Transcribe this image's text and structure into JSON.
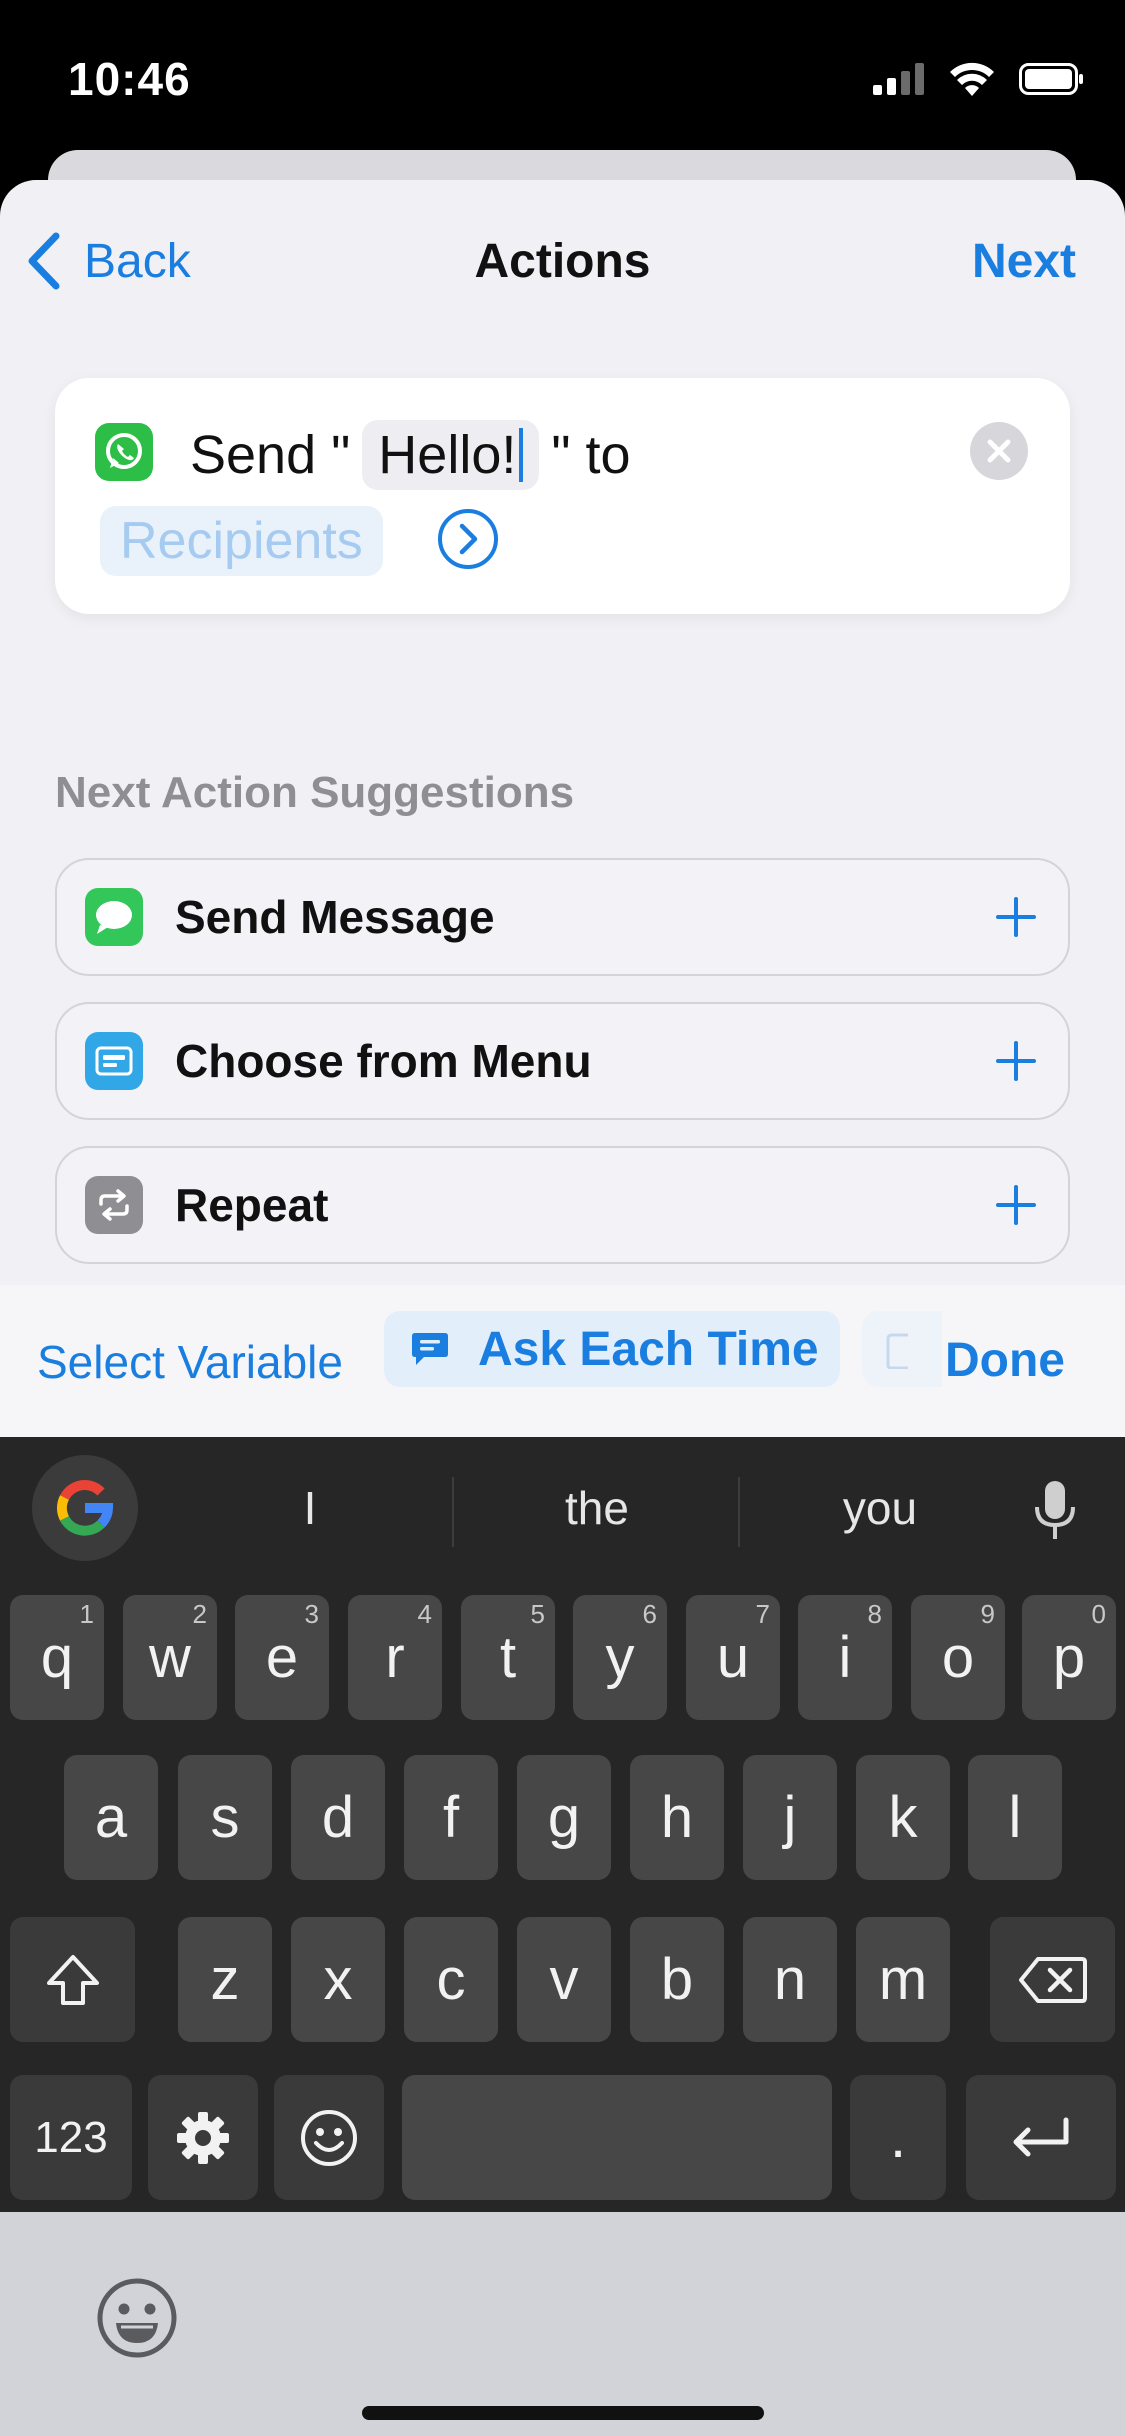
{
  "status": {
    "time": "10:46"
  },
  "nav": {
    "back": "Back",
    "title": "Actions",
    "next": "Next"
  },
  "action": {
    "verb": "Send \"",
    "message": "Hello!",
    "to": "\" to",
    "recipients": "Recipients"
  },
  "suggestions": {
    "title": "Next Action Suggestions",
    "items": [
      {
        "label": "Send Message",
        "icon": "messages-icon",
        "color": "#33c759"
      },
      {
        "label": "Choose from Menu",
        "icon": "menu-icon",
        "color": "#32a7e8"
      },
      {
        "label": "Repeat",
        "icon": "repeat-icon",
        "color": "#8e8e93"
      }
    ]
  },
  "variable_bar": {
    "select": "Select Variable",
    "ask": "Ask Each Time",
    "done": "Done"
  },
  "keyboard": {
    "suggestions": [
      "I",
      "the",
      "you"
    ],
    "row1": [
      {
        "k": "q",
        "h": "1"
      },
      {
        "k": "w",
        "h": "2"
      },
      {
        "k": "e",
        "h": "3"
      },
      {
        "k": "r",
        "h": "4"
      },
      {
        "k": "t",
        "h": "5"
      },
      {
        "k": "y",
        "h": "6"
      },
      {
        "k": "u",
        "h": "7"
      },
      {
        "k": "i",
        "h": "8"
      },
      {
        "k": "o",
        "h": "9"
      },
      {
        "k": "p",
        "h": "0"
      }
    ],
    "row2": [
      "a",
      "s",
      "d",
      "f",
      "g",
      "h",
      "j",
      "k",
      "l"
    ],
    "row3": [
      "z",
      "x",
      "c",
      "v",
      "b",
      "n",
      "m"
    ],
    "num_key": "123",
    "period": "."
  },
  "colors": {
    "accent": "#1a7ee0",
    "whatsapp": "#2dbe47"
  }
}
